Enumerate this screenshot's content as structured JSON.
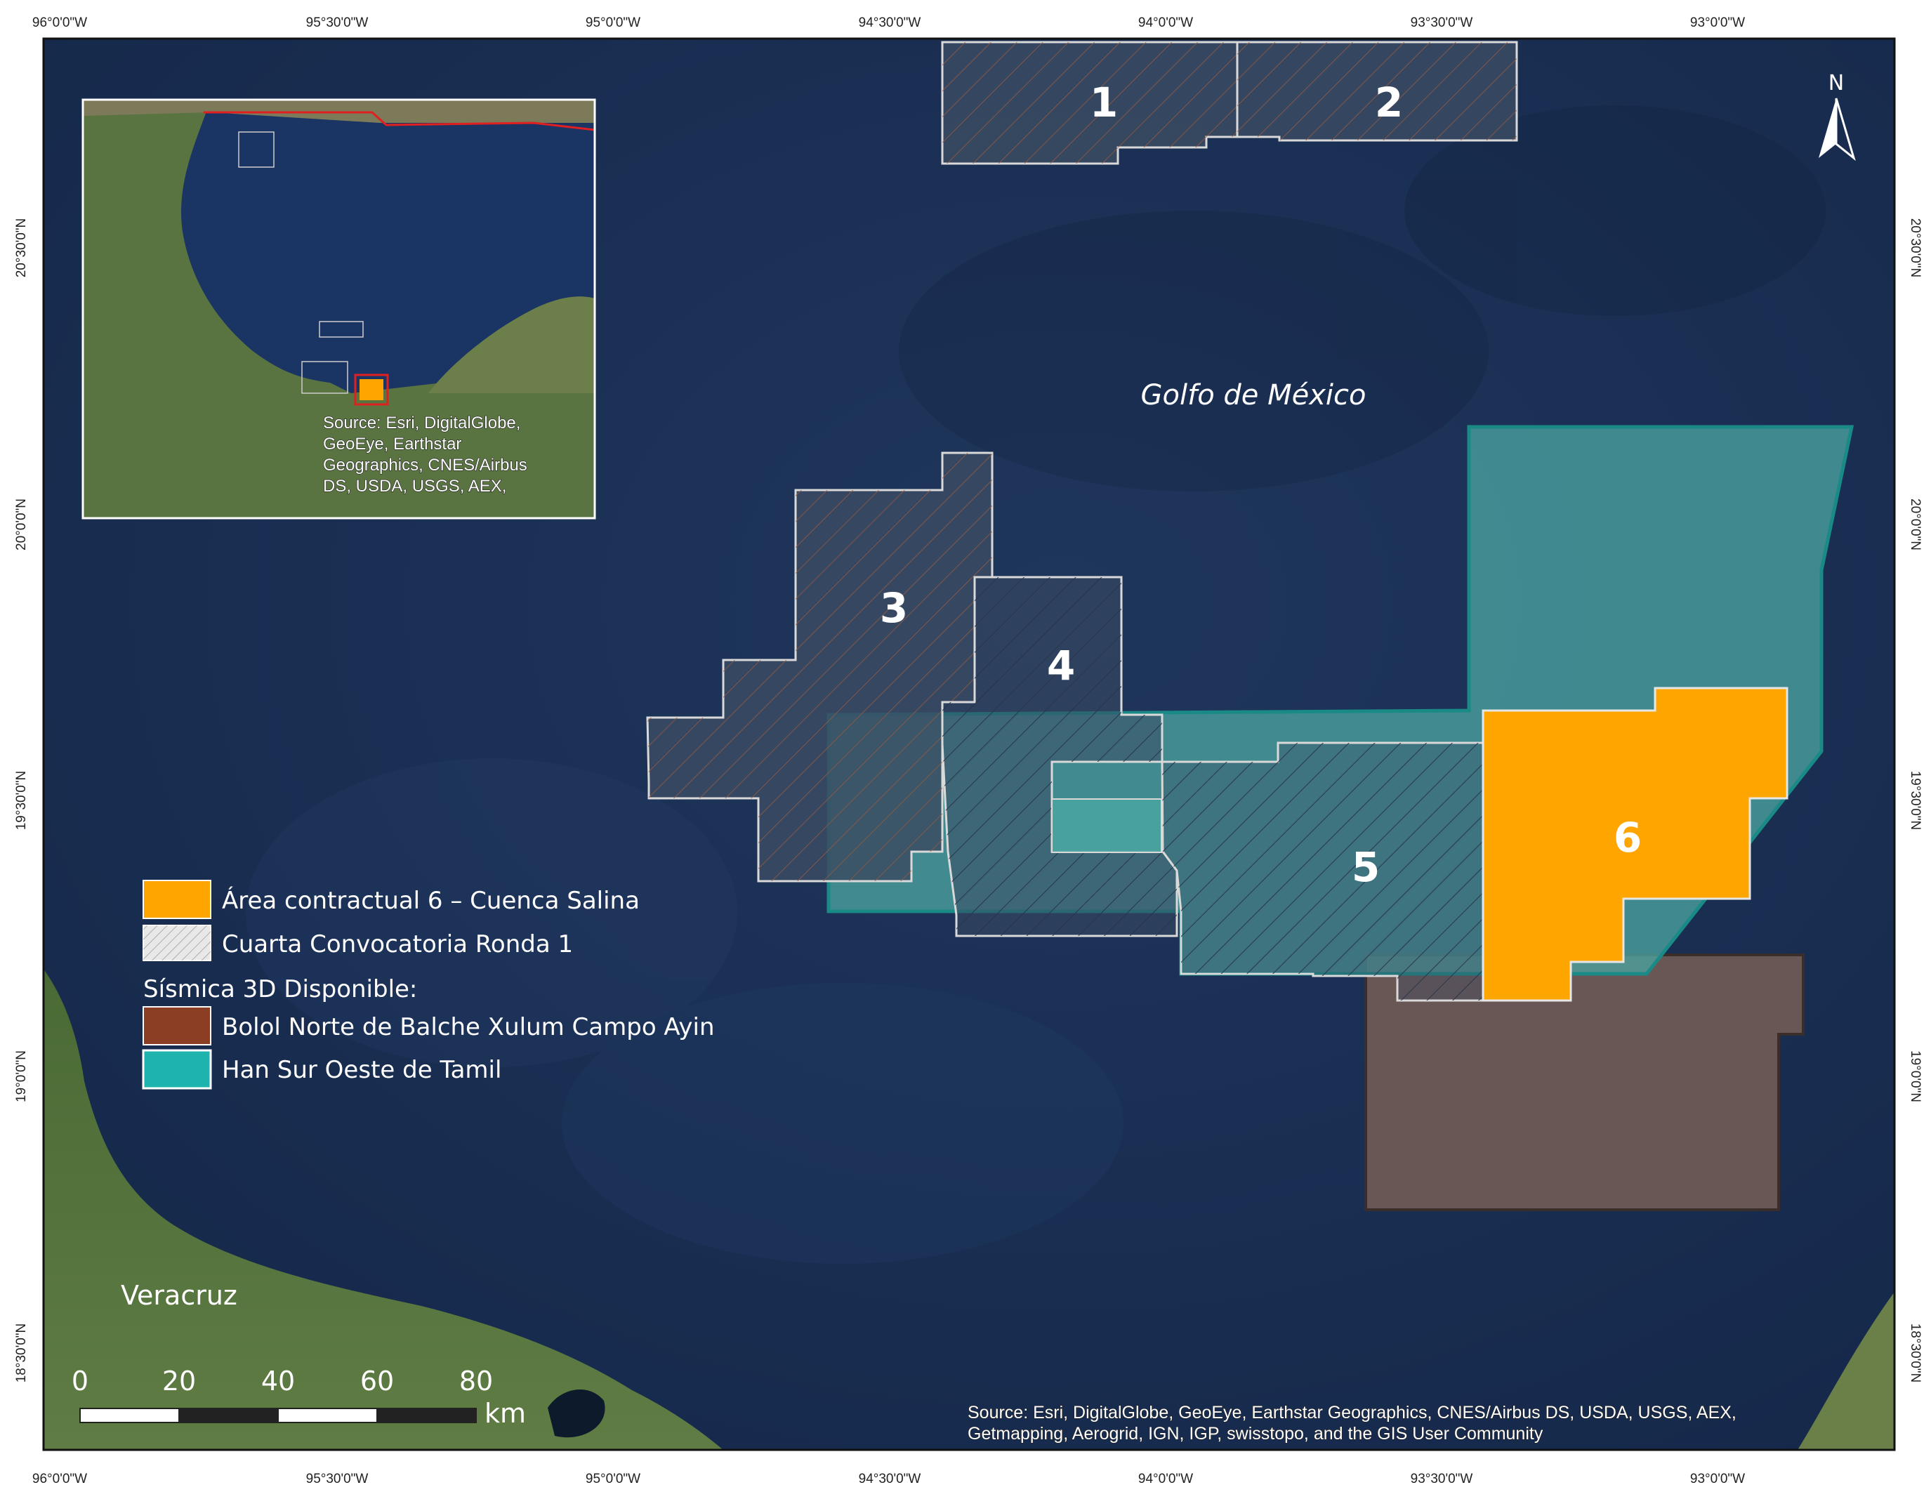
{
  "map": {
    "sea_label": "Golfo de México",
    "place_label": "Veracruz",
    "north_label": "N",
    "credit": [
      "Source: Esri, DigitalGlobe, GeoEye, Earthstar Geographics, CNES/Airbus DS, USDA, USGS, AEX,",
      "Getmapping, Aerogrid, IGN, IGP, swisstopo, and the GIS User Community"
    ],
    "colors": {
      "sea": "#1b2f52",
      "sea_dark": "#142544",
      "land": "#4d6b37",
      "block_fill": "#3b4b63",
      "block_stroke": "#d9d9d9",
      "contract_area": "#ffa500",
      "bolol_fill": "#6e5a55",
      "bolol_legend": "#8b3e23",
      "han_fill": "#4aa3a0",
      "han_stroke": "#1a8a86",
      "inset_highlight": "#e02020"
    }
  },
  "axes": {
    "longitude_ticks": [
      "96°0'0\"W",
      "95°30'0\"W",
      "95°0'0\"W",
      "94°30'0\"W",
      "94°0'0\"W",
      "93°30'0\"W",
      "93°0'0\"W"
    ],
    "latitude_ticks": [
      "20°30'0\"N",
      "20°0'0\"N",
      "19°30'0\"N",
      "19°0'0\"N",
      "18°30'0\"N"
    ]
  },
  "blocks": [
    "1",
    "2",
    "3",
    "4",
    "5",
    "6"
  ],
  "legend": {
    "items": [
      {
        "label": "Área contractual 6 – Cuenca Salina",
        "swatch": "contract"
      },
      {
        "label": "Cuarta Convocatoria Ronda 1",
        "swatch": "hatched"
      }
    ],
    "subheading": "Sísmica 3D Disponible:",
    "seismic_items": [
      {
        "label": "Bolol Norte de Balche Xulum Campo Ayin",
        "swatch": "bolol"
      },
      {
        "label": "Han Sur Oeste de Tamil",
        "swatch": "han"
      }
    ]
  },
  "scale_bar": {
    "ticks": [
      "0",
      "20",
      "40",
      "60",
      "80"
    ],
    "unit": "km"
  },
  "inset": {
    "credit": [
      "Source: Esri, DigitalGlobe,",
      "GeoEye, Earthstar",
      "Geographics, CNES/Airbus",
      "DS, USDA, USGS, AEX,"
    ]
  }
}
